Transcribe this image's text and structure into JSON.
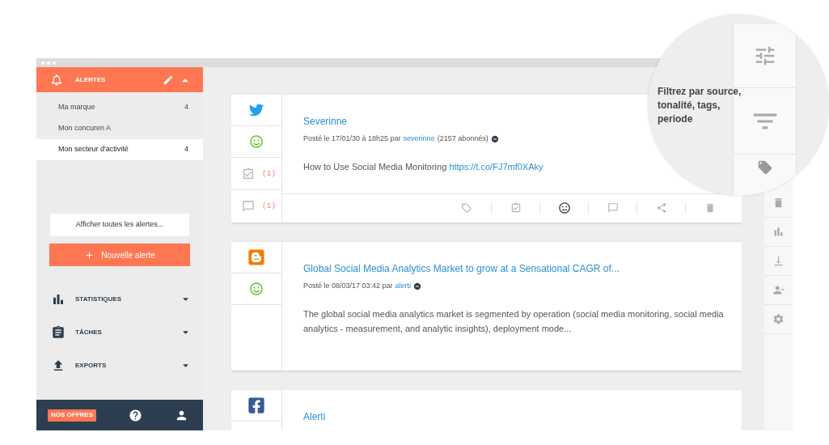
{
  "sidebar": {
    "header": {
      "title": "ALERTES"
    },
    "alerts": [
      {
        "name": "Ma marque",
        "count": "4",
        "selected": false
      },
      {
        "name": "Mon concuren A",
        "selected": false
      },
      {
        "name": "Mon secteur d'activité",
        "count": "4",
        "selected": true
      }
    ],
    "show_all_button": "Afficher toutes les alertes...",
    "new_alert_button": "Nouvelle alerte",
    "sections": [
      {
        "label": "STATISTIQUES",
        "kind": "stats"
      },
      {
        "label": "TÂCHES",
        "kind": "tasks"
      },
      {
        "label": "EXPORTS",
        "kind": "exports"
      }
    ],
    "footer": {
      "offers_button": "NOS OFFRES"
    }
  },
  "posts": [
    {
      "kind": "twitter",
      "positive": true,
      "title": "Severinne",
      "meta_prefix": "Posté le 17/01/30 à 18h25 par",
      "author": "severinne",
      "meta_suffix": "(2157 abonnés)",
      "body": "How to Use Social Media Monitoring",
      "link": "https://t.co/FJ7mf0XAky",
      "task_count": "(1)",
      "comment_count": "(1)",
      "toolbar": true
    },
    {
      "kind": "blogger",
      "positive": true,
      "title": "Global Social Media Analytics Market to grow at a Sensational CAGR of...",
      "meta_prefix": "Posté le 08/03/17 03:42 par",
      "author": "alerti",
      "body": "The global social media analytics market is segmented by operation (social media monitoring, social media analytics - measurement, and analytic insights), deployment mode...",
      "toolbar": false
    },
    {
      "kind": "facebook",
      "title": "Alerti",
      "toolbar": false
    }
  ],
  "callout": {
    "text": "Filtrez par source, tonalité, tags, periode"
  }
}
